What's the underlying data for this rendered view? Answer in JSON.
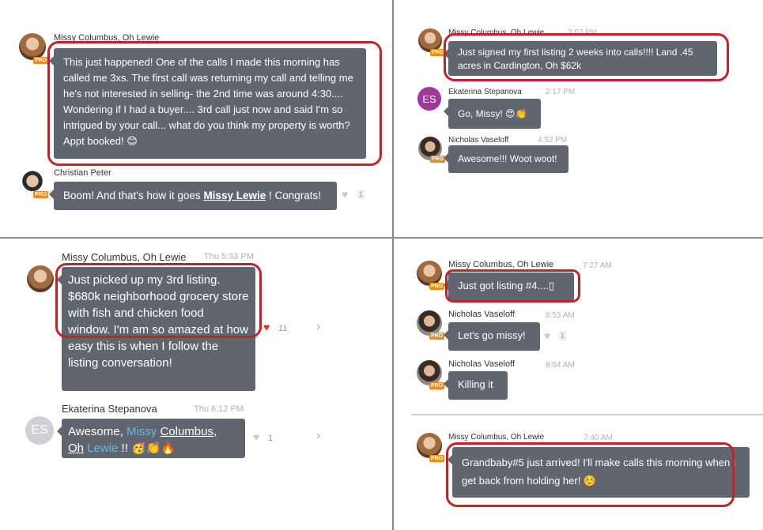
{
  "panels": {
    "top_left": {
      "msg1": {
        "author": "Missy Columbus, Oh Lewie",
        "text": "This just happened! One of the calls I made this morning has called me 3xs. The first call was returning my call and telling me he's not interested in selling- the 2nd time was around 4:30.... Wondering if I had a buyer.... 3rd call just now and said I'm so intrigued by your call... what do you think my property is worth? Appt booked! 😊"
      },
      "msg2": {
        "author": "Christian Peter",
        "text_before": "Boom! And that's how it goes ",
        "mention": "Missy Lewie",
        "text_after": " ! Congrats!",
        "likes": "1"
      }
    },
    "top_right": {
      "msg1": {
        "author": "Missy Columbus, Oh Lewie",
        "time": "2:02 PM",
        "text": "Just signed my first listing 2 weeks into calls!!!! Land .45 acres in Cardington, Oh $62k"
      },
      "msg2": {
        "author": "Ekaterina Stepanova",
        "initials": "ES",
        "time": "2:17 PM",
        "text": "Go, Missy! 😍👏"
      },
      "msg3": {
        "author": "Nicholas Vaseloff",
        "time": "4:52 PM",
        "text": "Awesome!!! Woot woot!"
      }
    },
    "bottom_left": {
      "msg1": {
        "author": "Missy Columbus, Oh Lewie",
        "time": "Thu 5:33 PM",
        "text": "Just picked up my 3rd listing. $680k neighborhood grocery store with fish and chicken food window. I'm am so amazed at how easy this is when I follow the listing conversation!",
        "likes": "11"
      },
      "msg2": {
        "author": "Ekaterina Stepanova",
        "initials": "ES",
        "time": "Thu 6:12 PM",
        "text_before": "Awesome, ",
        "mention_a": "Missy",
        "mention_b": "Columbus,",
        "mention_c": "Oh",
        "mention_d": "Lewie",
        "text_after": " !! 🥳👏🔥",
        "likes": "1"
      }
    },
    "bottom_right": {
      "msg1": {
        "author": "Missy Columbus, Oh Lewie",
        "time": "7:27 AM",
        "text": "Just got listing #4....▯"
      },
      "msg2": {
        "author": "Nicholas Vaseloff",
        "time": "8:53 AM",
        "text": "Let's go missy!",
        "likes": "1"
      },
      "msg3": {
        "author": "Nicholas Vaseloff",
        "time": "8:54 AM",
        "text": "Killing it"
      },
      "msg4": {
        "author": "Missy Columbus, Oh Lewie",
        "time": "7:40 AM",
        "text": "Grandbaby#5 just arrived! I'll make calls this morning when I get back from holding her! ☺️"
      }
    }
  },
  "badge_label": "PRO",
  "colors": {
    "bubble": "#5f6670",
    "highlight": "#c0242b",
    "pro_badge": "#f08a1c",
    "link": "#6ab7e8"
  }
}
